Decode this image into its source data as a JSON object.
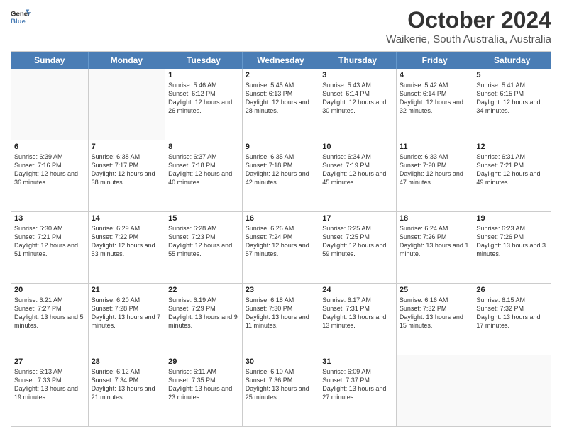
{
  "header": {
    "logo_general": "General",
    "logo_blue": "Blue",
    "title": "October 2024",
    "location": "Waikerie, South Australia, Australia"
  },
  "days_of_week": [
    "Sunday",
    "Monday",
    "Tuesday",
    "Wednesday",
    "Thursday",
    "Friday",
    "Saturday"
  ],
  "weeks": [
    [
      {
        "day": "",
        "sunrise": "",
        "sunset": "",
        "daylight": "",
        "empty": true
      },
      {
        "day": "",
        "sunrise": "",
        "sunset": "",
        "daylight": "",
        "empty": true
      },
      {
        "day": "1",
        "sunrise": "Sunrise: 5:46 AM",
        "sunset": "Sunset: 6:12 PM",
        "daylight": "Daylight: 12 hours and 26 minutes.",
        "empty": false
      },
      {
        "day": "2",
        "sunrise": "Sunrise: 5:45 AM",
        "sunset": "Sunset: 6:13 PM",
        "daylight": "Daylight: 12 hours and 28 minutes.",
        "empty": false
      },
      {
        "day": "3",
        "sunrise": "Sunrise: 5:43 AM",
        "sunset": "Sunset: 6:14 PM",
        "daylight": "Daylight: 12 hours and 30 minutes.",
        "empty": false
      },
      {
        "day": "4",
        "sunrise": "Sunrise: 5:42 AM",
        "sunset": "Sunset: 6:14 PM",
        "daylight": "Daylight: 12 hours and 32 minutes.",
        "empty": false
      },
      {
        "day": "5",
        "sunrise": "Sunrise: 5:41 AM",
        "sunset": "Sunset: 6:15 PM",
        "daylight": "Daylight: 12 hours and 34 minutes.",
        "empty": false
      }
    ],
    [
      {
        "day": "6",
        "sunrise": "Sunrise: 6:39 AM",
        "sunset": "Sunset: 7:16 PM",
        "daylight": "Daylight: 12 hours and 36 minutes.",
        "empty": false
      },
      {
        "day": "7",
        "sunrise": "Sunrise: 6:38 AM",
        "sunset": "Sunset: 7:17 PM",
        "daylight": "Daylight: 12 hours and 38 minutes.",
        "empty": false
      },
      {
        "day": "8",
        "sunrise": "Sunrise: 6:37 AM",
        "sunset": "Sunset: 7:18 PM",
        "daylight": "Daylight: 12 hours and 40 minutes.",
        "empty": false
      },
      {
        "day": "9",
        "sunrise": "Sunrise: 6:35 AM",
        "sunset": "Sunset: 7:18 PM",
        "daylight": "Daylight: 12 hours and 42 minutes.",
        "empty": false
      },
      {
        "day": "10",
        "sunrise": "Sunrise: 6:34 AM",
        "sunset": "Sunset: 7:19 PM",
        "daylight": "Daylight: 12 hours and 45 minutes.",
        "empty": false
      },
      {
        "day": "11",
        "sunrise": "Sunrise: 6:33 AM",
        "sunset": "Sunset: 7:20 PM",
        "daylight": "Daylight: 12 hours and 47 minutes.",
        "empty": false
      },
      {
        "day": "12",
        "sunrise": "Sunrise: 6:31 AM",
        "sunset": "Sunset: 7:21 PM",
        "daylight": "Daylight: 12 hours and 49 minutes.",
        "empty": false
      }
    ],
    [
      {
        "day": "13",
        "sunrise": "Sunrise: 6:30 AM",
        "sunset": "Sunset: 7:21 PM",
        "daylight": "Daylight: 12 hours and 51 minutes.",
        "empty": false
      },
      {
        "day": "14",
        "sunrise": "Sunrise: 6:29 AM",
        "sunset": "Sunset: 7:22 PM",
        "daylight": "Daylight: 12 hours and 53 minutes.",
        "empty": false
      },
      {
        "day": "15",
        "sunrise": "Sunrise: 6:28 AM",
        "sunset": "Sunset: 7:23 PM",
        "daylight": "Daylight: 12 hours and 55 minutes.",
        "empty": false
      },
      {
        "day": "16",
        "sunrise": "Sunrise: 6:26 AM",
        "sunset": "Sunset: 7:24 PM",
        "daylight": "Daylight: 12 hours and 57 minutes.",
        "empty": false
      },
      {
        "day": "17",
        "sunrise": "Sunrise: 6:25 AM",
        "sunset": "Sunset: 7:25 PM",
        "daylight": "Daylight: 12 hours and 59 minutes.",
        "empty": false
      },
      {
        "day": "18",
        "sunrise": "Sunrise: 6:24 AM",
        "sunset": "Sunset: 7:26 PM",
        "daylight": "Daylight: 13 hours and 1 minute.",
        "empty": false
      },
      {
        "day": "19",
        "sunrise": "Sunrise: 6:23 AM",
        "sunset": "Sunset: 7:26 PM",
        "daylight": "Daylight: 13 hours and 3 minutes.",
        "empty": false
      }
    ],
    [
      {
        "day": "20",
        "sunrise": "Sunrise: 6:21 AM",
        "sunset": "Sunset: 7:27 PM",
        "daylight": "Daylight: 13 hours and 5 minutes.",
        "empty": false
      },
      {
        "day": "21",
        "sunrise": "Sunrise: 6:20 AM",
        "sunset": "Sunset: 7:28 PM",
        "daylight": "Daylight: 13 hours and 7 minutes.",
        "empty": false
      },
      {
        "day": "22",
        "sunrise": "Sunrise: 6:19 AM",
        "sunset": "Sunset: 7:29 PM",
        "daylight": "Daylight: 13 hours and 9 minutes.",
        "empty": false
      },
      {
        "day": "23",
        "sunrise": "Sunrise: 6:18 AM",
        "sunset": "Sunset: 7:30 PM",
        "daylight": "Daylight: 13 hours and 11 minutes.",
        "empty": false
      },
      {
        "day": "24",
        "sunrise": "Sunrise: 6:17 AM",
        "sunset": "Sunset: 7:31 PM",
        "daylight": "Daylight: 13 hours and 13 minutes.",
        "empty": false
      },
      {
        "day": "25",
        "sunrise": "Sunrise: 6:16 AM",
        "sunset": "Sunset: 7:32 PM",
        "daylight": "Daylight: 13 hours and 15 minutes.",
        "empty": false
      },
      {
        "day": "26",
        "sunrise": "Sunrise: 6:15 AM",
        "sunset": "Sunset: 7:32 PM",
        "daylight": "Daylight: 13 hours and 17 minutes.",
        "empty": false
      }
    ],
    [
      {
        "day": "27",
        "sunrise": "Sunrise: 6:13 AM",
        "sunset": "Sunset: 7:33 PM",
        "daylight": "Daylight: 13 hours and 19 minutes.",
        "empty": false
      },
      {
        "day": "28",
        "sunrise": "Sunrise: 6:12 AM",
        "sunset": "Sunset: 7:34 PM",
        "daylight": "Daylight: 13 hours and 21 minutes.",
        "empty": false
      },
      {
        "day": "29",
        "sunrise": "Sunrise: 6:11 AM",
        "sunset": "Sunset: 7:35 PM",
        "daylight": "Daylight: 13 hours and 23 minutes.",
        "empty": false
      },
      {
        "day": "30",
        "sunrise": "Sunrise: 6:10 AM",
        "sunset": "Sunset: 7:36 PM",
        "daylight": "Daylight: 13 hours and 25 minutes.",
        "empty": false
      },
      {
        "day": "31",
        "sunrise": "Sunrise: 6:09 AM",
        "sunset": "Sunset: 7:37 PM",
        "daylight": "Daylight: 13 hours and 27 minutes.",
        "empty": false
      },
      {
        "day": "",
        "sunrise": "",
        "sunset": "",
        "daylight": "",
        "empty": true
      },
      {
        "day": "",
        "sunrise": "",
        "sunset": "",
        "daylight": "",
        "empty": true
      }
    ]
  ]
}
